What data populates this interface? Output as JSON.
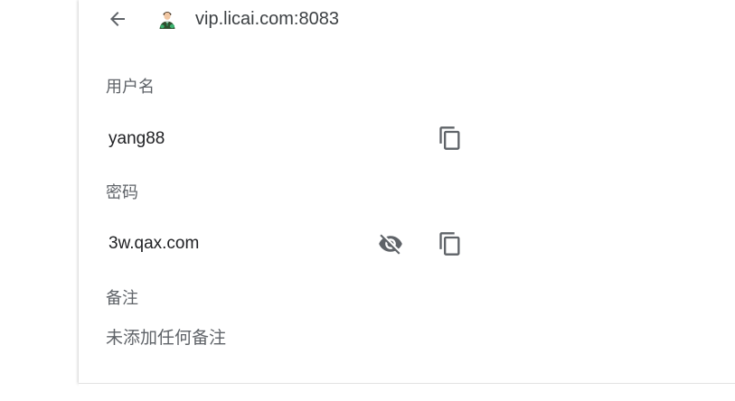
{
  "header": {
    "site": "vip.licai.com:8083",
    "back_icon": "arrow-back-icon",
    "site_icon": "site-favicon-icon"
  },
  "username": {
    "label": "用户名",
    "value": "yang88",
    "copy_icon": "copy-icon"
  },
  "password": {
    "label": "密码",
    "value": "3w.qax.com",
    "visibility_icon": "eye-off-icon",
    "copy_icon": "copy-icon"
  },
  "note": {
    "label": "备注",
    "value": "未添加任何备注"
  },
  "colors": {
    "text_primary": "#202124",
    "text_secondary": "#5f6368",
    "icon": "#5f6368"
  }
}
